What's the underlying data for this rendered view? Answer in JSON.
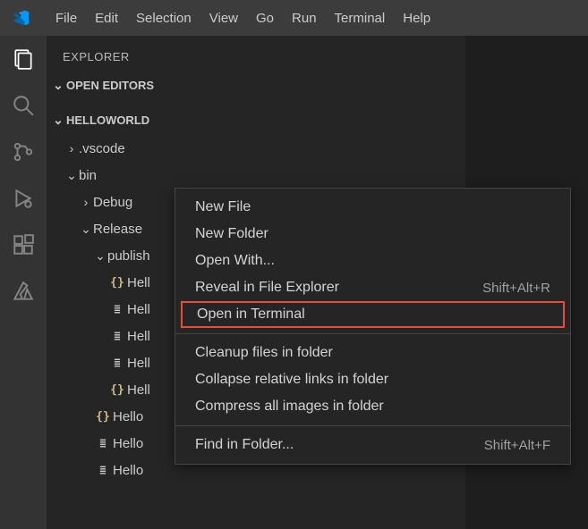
{
  "menubar": {
    "items": [
      "File",
      "Edit",
      "Selection",
      "View",
      "Go",
      "Run",
      "Terminal",
      "Help"
    ]
  },
  "sidebar": {
    "title": "EXPLORER",
    "open_editors": "OPEN EDITORS",
    "project": "HELLOWORLD",
    "tree": {
      "vscode": ".vscode",
      "bin": "bin",
      "debug": "Debug",
      "release": "Release",
      "publish": "publish",
      "files": [
        "Hell",
        "Hell",
        "Hell",
        "Hell",
        "Hell"
      ],
      "hello1": "Hello",
      "hello2": "Hello",
      "hello3": "Hello"
    }
  },
  "context_menu": {
    "new_file": "New File",
    "new_folder": "New Folder",
    "open_with": "Open With...",
    "reveal": "Reveal in File Explorer",
    "reveal_short": "Shift+Alt+R",
    "open_terminal": "Open in Terminal",
    "cleanup": "Cleanup files in folder",
    "collapse": "Collapse relative links in folder",
    "compress": "Compress all images in folder",
    "find": "Find in Folder...",
    "find_short": "Shift+Alt+F"
  }
}
